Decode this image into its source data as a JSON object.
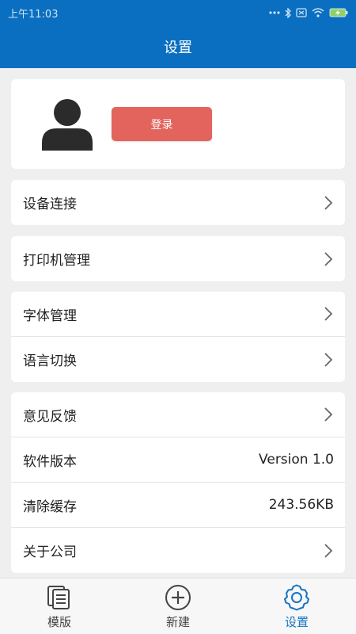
{
  "status_bar": {
    "time": "上午11:03",
    "icons": [
      "dots-icon",
      "bluetooth-icon",
      "sim-icon",
      "wifi-icon",
      "battery-icon"
    ]
  },
  "header": {
    "title": "设置"
  },
  "profile": {
    "avatar_icon": "person-icon",
    "login_label": "登录"
  },
  "sections": {
    "device": {
      "label": "设备连接"
    },
    "printer": {
      "label": "打印机管理"
    },
    "font": {
      "label": "字体管理"
    },
    "language": {
      "label": "语言切换"
    },
    "feedback": {
      "label": "意见反馈"
    },
    "version": {
      "label": "软件版本",
      "value": "Version 1.0"
    },
    "cache": {
      "label": "清除缓存",
      "value": "243.56KB"
    },
    "about": {
      "label": "关于公司"
    }
  },
  "bottom_nav": {
    "templates": "模版",
    "new": "新建",
    "settings": "设置"
  },
  "colors": {
    "primary": "#0a6fc0",
    "login_button": "#e2645c",
    "active_tab": "#1474c4"
  }
}
